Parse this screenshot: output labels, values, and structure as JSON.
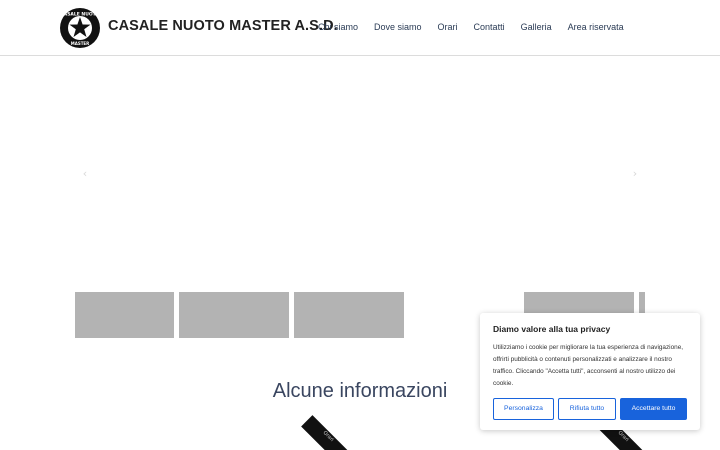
{
  "header": {
    "logo_text_top": "CASALE NUOTO",
    "logo_text_bottom": "MASTER",
    "site_title": "CASALE NUOTO MASTER A.S.D."
  },
  "nav": {
    "items": [
      {
        "label": "Chi siamo"
      },
      {
        "label": "Dove siamo"
      },
      {
        "label": "Orari"
      },
      {
        "label": "Contatti"
      },
      {
        "label": "Galleria"
      },
      {
        "label": "Area riservata"
      }
    ]
  },
  "slider": {
    "prev_icon": "chevron-left-icon",
    "next_icon": "chevron-right-icon",
    "prev_glyph": "‹",
    "next_glyph": "›"
  },
  "section": {
    "title": "Alcune informazioni"
  },
  "ribbons": {
    "left_label": "Orari",
    "right_label": "Orari"
  },
  "cookie": {
    "title": "Diamo valore alla tua privacy",
    "text": "Utilizziamo i cookie per migliorare la tua esperienza di navigazione, offrirti pubblicità o contenuti personalizzati e analizzare il nostro traffico. Cliccando \"Accetta tutti\", acconsenti al nostro utilizzo dei cookie.",
    "btn_customize": "Personalizza",
    "btn_reject": "Rifiuta tutto",
    "btn_accept": "Accettare tutto"
  },
  "colors": {
    "accent": "#1863dc",
    "nav_text": "#2a3b55",
    "placeholder": "#b3b3b3"
  }
}
